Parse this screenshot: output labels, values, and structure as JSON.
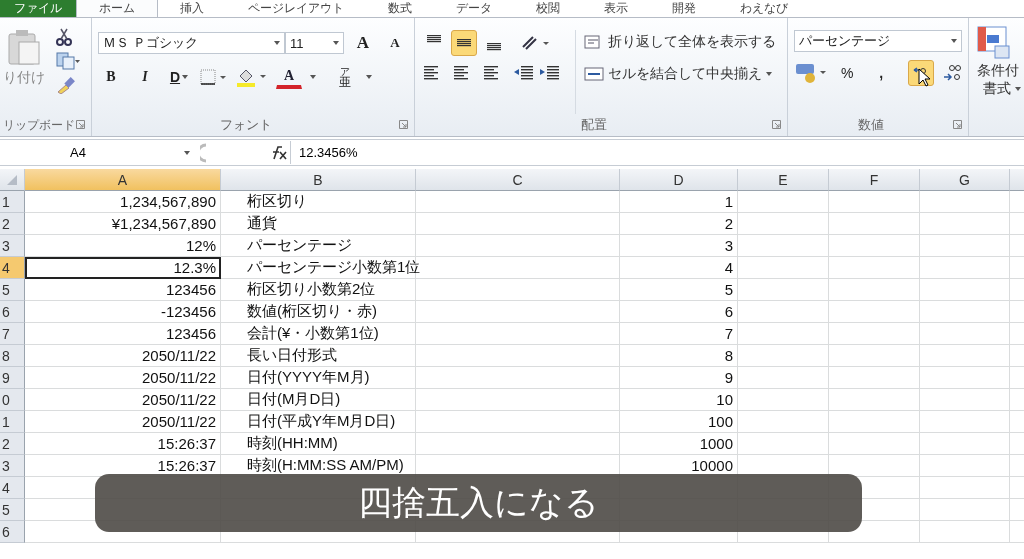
{
  "tabs": [
    {
      "label": "ファイル",
      "kind": "file",
      "selected": false
    },
    {
      "label": "ホーム",
      "kind": "tab",
      "selected": true
    },
    {
      "label": "挿入",
      "kind": "tab",
      "selected": false
    },
    {
      "label": "ページレイアウト",
      "kind": "tab",
      "selected": false
    },
    {
      "label": "数式",
      "kind": "tab",
      "selected": false
    },
    {
      "label": "データ",
      "kind": "tab",
      "selected": false
    },
    {
      "label": "校閲",
      "kind": "tab",
      "selected": false
    },
    {
      "label": "表示",
      "kind": "tab",
      "selected": false
    },
    {
      "label": "開発",
      "kind": "tab",
      "selected": false
    },
    {
      "label": "わえなび",
      "kind": "tab",
      "selected": false
    }
  ],
  "ribbon": {
    "clipboard": {
      "paste_label": "り付け",
      "group_label": "リップボード"
    },
    "font": {
      "font_name": "ＭＳ Ｐゴシック",
      "font_size": "11",
      "grow": "A",
      "shrink": "A",
      "bold": "B",
      "italic": "I",
      "underline": "D",
      "font_color": "A",
      "phonetic": "亜",
      "phonetic_ruby": "ア",
      "group_label": "フォント"
    },
    "alignment": {
      "vertical": [
        {
          "selected": false
        },
        {
          "selected": true
        },
        {
          "selected": false
        }
      ],
      "wrap_label": "折り返して全体を表示する",
      "merge_label": "セルを結合して中央揃え",
      "group_label": "配置"
    },
    "number": {
      "format": "パーセンテージ",
      "percent": "%",
      "comma": ",",
      "decrease_decimal_hovered": true,
      "group_label": "数値"
    },
    "styles": {
      "label_1": "条件付",
      "label_2": "書式"
    }
  },
  "formula_bar": {
    "name_box": "A4",
    "value": "12.3456%"
  },
  "sheet": {
    "columns": [
      {
        "label": "A",
        "selected": true
      },
      {
        "label": "B",
        "selected": false
      },
      {
        "label": "C",
        "selected": false
      },
      {
        "label": "D",
        "selected": false
      },
      {
        "label": "E",
        "selected": false
      },
      {
        "label": "F",
        "selected": false
      },
      {
        "label": "G",
        "selected": false
      }
    ],
    "rows": [
      {
        "number": "1",
        "selected": false,
        "a": "1,234,567,890",
        "b": "桁区切り",
        "d": "1"
      },
      {
        "number": "2",
        "selected": false,
        "a": "¥1,234,567,890",
        "b": "通貨",
        "d": "2"
      },
      {
        "number": "3",
        "selected": false,
        "a": "12%",
        "b": "パーセンテージ",
        "d": "3"
      },
      {
        "number": "4",
        "selected": true,
        "a": "12.3%",
        "b": "パーセンテージ小数第1位",
        "d": "4"
      },
      {
        "number": "5",
        "selected": false,
        "a": "123456",
        "b": "桁区切り小数第2位",
        "d": "5"
      },
      {
        "number": "6",
        "selected": false,
        "a": "-123456",
        "b": "数値(桁区切り・赤)",
        "d": "6"
      },
      {
        "number": "7",
        "selected": false,
        "a": "123456",
        "b": "会計(¥・小数第1位)",
        "d": "7"
      },
      {
        "number": "8",
        "selected": false,
        "a": "2050/11/22",
        "b": "長い日付形式",
        "d": "8"
      },
      {
        "number": "9",
        "selected": false,
        "a": "2050/11/22",
        "b": "日付(YYYY年M月)",
        "d": "9"
      },
      {
        "number": "0",
        "selected": false,
        "a": "2050/11/22",
        "b": "日付(M月D日)",
        "d": "10"
      },
      {
        "number": "1",
        "selected": false,
        "a": "2050/11/22",
        "b": "日付(平成Y年M月D日)",
        "d": "100"
      },
      {
        "number": "2",
        "selected": false,
        "a": "15:26:37",
        "b": "時刻(HH:MM)",
        "d": "1000"
      },
      {
        "number": "3",
        "selected": false,
        "a": "15:26:37",
        "b": "時刻(H:MM:SS AM/PM)",
        "d": "10000"
      },
      {
        "number": "4",
        "selected": false,
        "a": "",
        "b": "",
        "d": ""
      },
      {
        "number": "5",
        "selected": false,
        "a": "",
        "b": "",
        "d": ""
      },
      {
        "number": "6",
        "selected": false,
        "a": "",
        "b": "",
        "d": ""
      }
    ]
  },
  "caption": "四捨五入になる"
}
